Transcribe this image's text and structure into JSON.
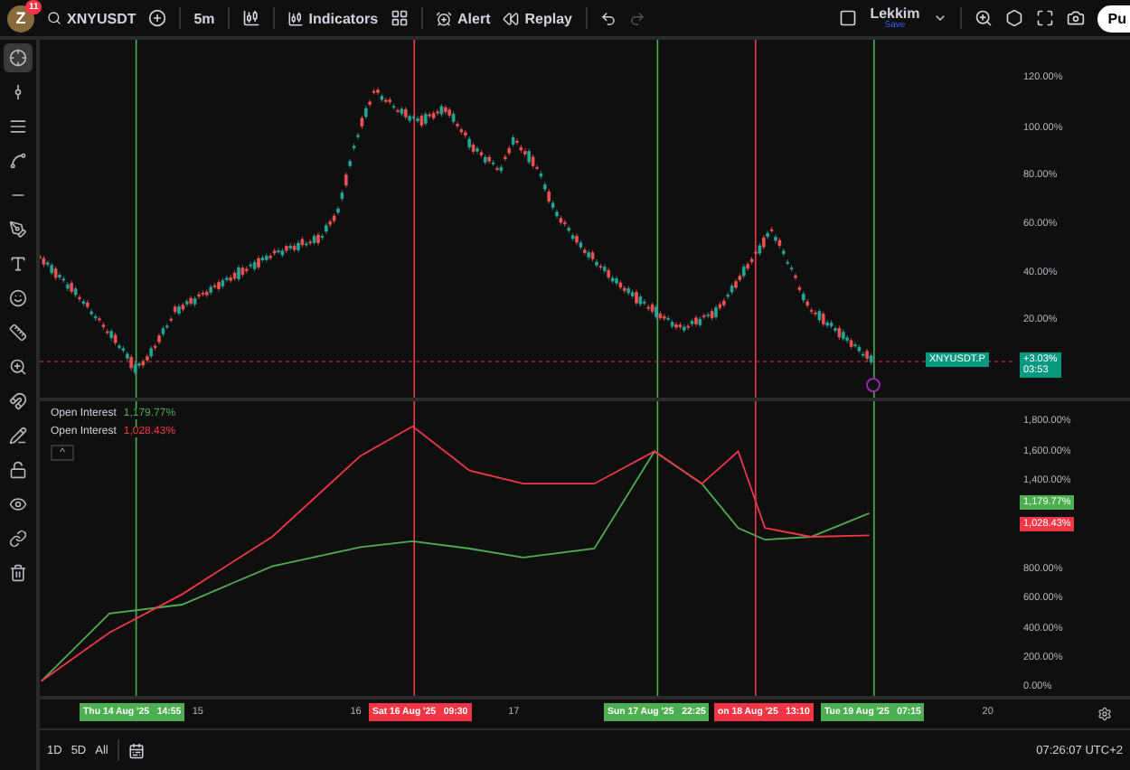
{
  "top_bar": {
    "avatar": "Z",
    "badge": "11",
    "symbol": "XNYUSDT",
    "interval": "5m",
    "indicators": "Indicators",
    "alert": "Alert",
    "replay": "Replay",
    "layout_name": "Lekkim",
    "layout_status": "Save",
    "publish": "Pu"
  },
  "tools": [
    {
      "selected": true
    },
    {
      "selected": false
    },
    {
      "selected": false
    },
    {
      "selected": false
    },
    {
      "selected": false
    },
    {
      "selected": false
    },
    {
      "selected": false
    },
    {
      "selected": false
    },
    {
      "selected": false
    },
    {
      "selected": false
    },
    {
      "selected": false
    },
    {
      "selected": false
    },
    {
      "selected": false
    },
    {
      "selected": false
    },
    {
      "selected": false
    },
    {
      "selected": false
    }
  ],
  "price_pane": {
    "axis_labels": [
      "120.00%",
      "100.00%",
      "80.00%",
      "60.00%",
      "40.00%",
      "20.00%"
    ],
    "symbol_tag": "XNYUSDT.P",
    "change": "+3.03%",
    "countdown": "03:53"
  },
  "oi_pane": {
    "legend": [
      {
        "label": "Open Interest",
        "value": "1,179.77%",
        "color": "#4caf50"
      },
      {
        "label": "Open Interest",
        "value": "1,028.43%",
        "color": "#f23645"
      }
    ],
    "collapse": "^",
    "value_tags": [
      {
        "value": "1,179.77%",
        "color": "#4caf50"
      },
      {
        "value": "1,028.43%",
        "color": "#f23645"
      }
    ],
    "chart_data": {
      "type": "line",
      "x": [
        14.01,
        14.44,
        14.9,
        15.47,
        16.03,
        16.36,
        16.72,
        17.06,
        17.51,
        17.89,
        18.19,
        18.42,
        18.59,
        18.88,
        19.25
      ],
      "series": [
        {
          "color": "#4caf50",
          "values": [
            40,
            500,
            560,
            820,
            950,
            990,
            940,
            880,
            940,
            1600,
            1380,
            1080,
            1000,
            1020,
            1180
          ]
        },
        {
          "color": "#f23645",
          "values": [
            40,
            370,
            630,
            1020,
            1570,
            1770,
            1470,
            1380,
            1380,
            1600,
            1380,
            1600,
            1080,
            1020,
            1030
          ]
        }
      ],
      "xlim": [
        14,
        20.9
      ],
      "ref_lines": [
        {
          "axis": "x",
          "value": 14.61,
          "color": "#4caf50"
        },
        {
          "axis": "x",
          "value": 16.37,
          "color": "#f23645"
        },
        {
          "axis": "x",
          "value": 17.91,
          "color": "#4caf50"
        },
        {
          "axis": "x",
          "value": 18.53,
          "color": "#f23645"
        },
        {
          "axis": "x",
          "value": 19.28,
          "color": "#4caf50"
        }
      ],
      "annotations": [
        "Thu 14 Aug '25   14:55",
        "Sat 16 Aug '25   09:30",
        "Sun 17 Aug '25   22:25",
        "on 18 Aug '25   13:10",
        "Tue 19 Aug '25   07:15"
      ],
      "xticks": [
        {
          "value": 15,
          "label": "15"
        },
        {
          "value": 16,
          "label": "16"
        },
        {
          "value": 17,
          "label": "17"
        },
        {
          "value": 20,
          "label": "20"
        }
      ],
      "ylim": [
        -60,
        1940
      ],
      "yticks": [
        {
          "value": 1800,
          "label": "1,800.00%"
        },
        {
          "value": 1600,
          "label": "1,600.00%"
        },
        {
          "value": 1400,
          "label": "1,400.00%"
        },
        {
          "value": 800,
          "label": "800.00%"
        },
        {
          "value": 600,
          "label": "600.00%"
        },
        {
          "value": 400,
          "label": "400.00%"
        },
        {
          "value": 200,
          "label": "200.00%"
        },
        {
          "value": 0,
          "label": "0.00%"
        }
      ]
    }
  },
  "bottom_bar": {
    "ranges": [
      "1D",
      "5D",
      "All"
    ],
    "clock": "07:26:07 UTC+2"
  }
}
